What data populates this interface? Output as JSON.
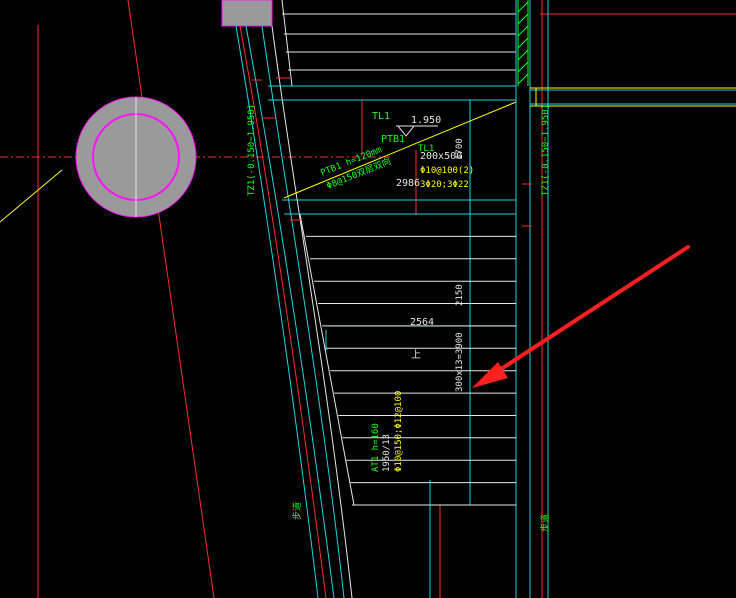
{
  "drawing": {
    "colors": {
      "background": "#000000",
      "axis_red": "#ff2a2a",
      "cyan": "#18d8e0",
      "white": "#e8e8e8",
      "yellow": "#ffff00",
      "green": "#18ff18",
      "magenta": "#ff10ff",
      "gray_fill": "#9a9a9a",
      "arrow": "#ff2020"
    },
    "labels": {
      "tl1_upper": "TL1",
      "level_value": "1.950",
      "ptb1": "PTB1",
      "tl1_lower": "TL1",
      "vert_1700": "1700",
      "beam_size": "200x500",
      "beam_stirrup": "Φ10@100(2)",
      "beam_bars": "3Φ20;3Φ22",
      "beam_length": "2986",
      "slab_line1": "PTB1 h=120mm",
      "slab_line2": "Φ8@150双层双向",
      "span_2564": "2564",
      "up_mark": "上",
      "vert_2150": "2150",
      "stair_steps": "300x13=3900",
      "tz_left": "TZ1(-0.150~1.950)",
      "tz_right": "TZ1(-0.150~1.950)",
      "at1_line1": "AT1 h=160",
      "at1_line2": "1950/13",
      "at1_line3": "Φ10@150;Φ12@100",
      "green_lower_left": "步道",
      "green_lower_right": "步道"
    }
  }
}
